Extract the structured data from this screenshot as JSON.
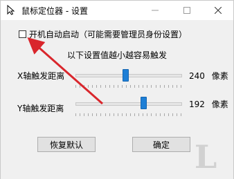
{
  "window": {
    "title": "鼠标定位器 - 设置",
    "icon": "cursor-arrow-icon",
    "controls": [
      "minimize-icon",
      "maximize-icon",
      "close-icon"
    ]
  },
  "settings": {
    "autostart": {
      "label": "开机自动启动（可能需要管理员身份设置）",
      "checked": false
    },
    "hint": "以下设置值越小越容易触发",
    "x_trigger": {
      "label": "X轴触发距离",
      "value": "240",
      "unit": "像素",
      "slider_fraction": 0.48
    },
    "y_trigger": {
      "label": "Y轴触发距离",
      "value": "192",
      "unit": "像素",
      "slider_fraction": 0.65
    }
  },
  "buttons": {
    "restore_default": "恢复默认",
    "confirm": "确定"
  },
  "annotation": {
    "arrow_color": "#d9262c"
  },
  "colors": {
    "slider_thumb": "#1e7fd6",
    "window_bg": "#f0f0f0"
  }
}
